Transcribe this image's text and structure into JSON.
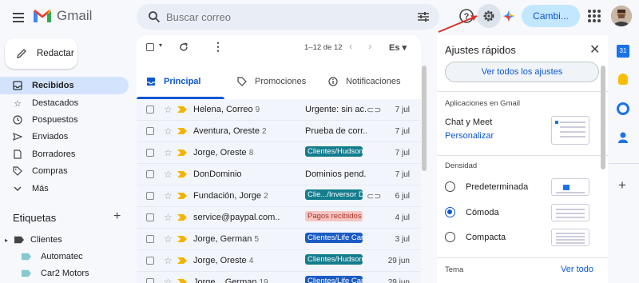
{
  "header": {
    "app_name": "Gmail",
    "search_placeholder": "Buscar correo",
    "change_label": "Cambi..."
  },
  "sidebar": {
    "compose": "Redactar",
    "items": [
      {
        "label": "Recibidos",
        "icon": "inbox-icon",
        "selected": true
      },
      {
        "label": "Destacados",
        "icon": "star-icon"
      },
      {
        "label": "Pospuestos",
        "icon": "clock-icon"
      },
      {
        "label": "Enviados",
        "icon": "send-icon"
      },
      {
        "label": "Borradores",
        "icon": "draft-icon"
      },
      {
        "label": "Compras",
        "icon": "tag-icon"
      },
      {
        "label": "Más",
        "icon": "chevron-down-icon"
      }
    ],
    "labels_title": "Etiquetas",
    "labels": [
      {
        "label": "Clientes",
        "level": 0
      },
      {
        "label": "Automatec",
        "level": 1
      },
      {
        "label": "Car2 Motors",
        "level": 1
      }
    ]
  },
  "toolbar": {
    "range": "1–12 de 12",
    "lang": "Es"
  },
  "tabs": [
    {
      "label": "Principal",
      "icon": "inbox-icon",
      "selected": true
    },
    {
      "label": "Promociones",
      "icon": "tag-icon"
    },
    {
      "label": "Notificaciones",
      "icon": "info-icon"
    }
  ],
  "emails": [
    {
      "sender": "Helena, Correo",
      "count": "9",
      "subject": "Urgente: sin ac...",
      "tag": "",
      "tag_style": "",
      "clip": true,
      "date": "7 jul"
    },
    {
      "sender": "Aventura, Oreste",
      "count": "2",
      "subject": "Prueba de corr...",
      "tag": "",
      "tag_style": "",
      "clip": false,
      "date": "7 jul"
    },
    {
      "sender": "Jorge, Oreste",
      "count": "8",
      "subject": "",
      "tag": "Clientes/Hudson C...",
      "tag_style": "teal",
      "clip": false,
      "date": "7 jul"
    },
    {
      "sender": "DonDominio",
      "count": "",
      "subject": "Dominios pend...",
      "tag": "",
      "tag_style": "",
      "clip": false,
      "date": "7 jul"
    },
    {
      "sender": "Fundación, Jorge",
      "count": "2",
      "subject": "",
      "tag": "Clie.../Inversor Dep...",
      "tag_style": "teal",
      "clip": true,
      "date": "6 jul"
    },
    {
      "sender": "service@paypal.com..",
      "count": "",
      "subject": "",
      "tag": "Pagos recibidos",
      "tag_style": "red",
      "clip": false,
      "date": "4 jul"
    },
    {
      "sender": "Jorge, German",
      "count": "5",
      "subject": "",
      "tag": "Clientes/Life Cargo...",
      "tag_style": "blue",
      "clip": false,
      "date": "3 jul"
    },
    {
      "sender": "Jorge, Oreste",
      "count": "4",
      "subject": "",
      "tag": "Clientes/Hudson C...",
      "tag_style": "teal",
      "clip": false,
      "date": "29 jun"
    },
    {
      "sender": "Jorge .. German",
      "count": "19",
      "subject": "",
      "tag": "Clientes/Life Cargo...",
      "tag_style": "blue",
      "clip": false,
      "date": "29 jun"
    }
  ],
  "quick_settings": {
    "title": "Ajustes rápidos",
    "see_all": "Ver todos los ajustes",
    "apps_heading": "Aplicaciones en Gmail",
    "chat_meet": "Chat y Meet",
    "customize": "Personalizar",
    "density_heading": "Densidad",
    "density_options": [
      {
        "label": "Predeterminada",
        "selected": false
      },
      {
        "label": "Cómoda",
        "selected": true
      },
      {
        "label": "Compacta",
        "selected": false
      }
    ],
    "theme_heading": "Tema",
    "theme_link": "Ver todo"
  },
  "colors": {
    "accent": "#0b57d0",
    "selected_nav": "#d3e3fd",
    "annotation_arrow": "#d93025"
  }
}
